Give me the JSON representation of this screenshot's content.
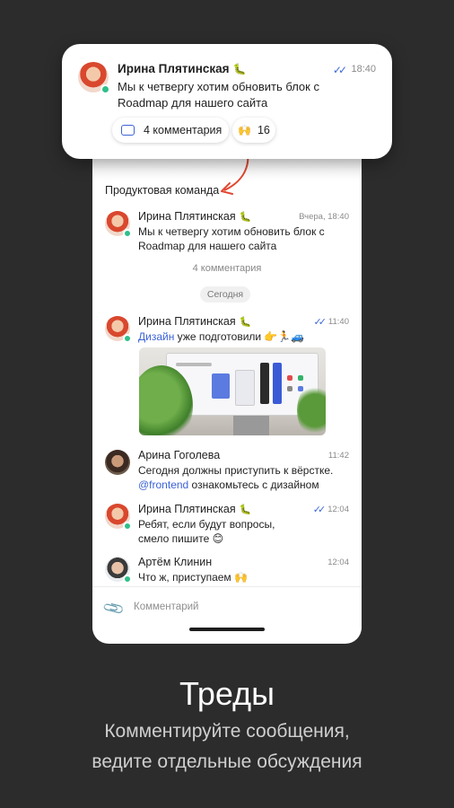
{
  "notification": {
    "name": "Ирина Плятинская",
    "name_emoji": "🐛",
    "ticks": "✓✓",
    "time": "18:40",
    "text": "Мы к четвергу хотим обновить блок с Roadmap для нашего сайта",
    "comments_chip": "4 комментария",
    "reaction_emoji": "🙌",
    "reaction_count": "16"
  },
  "thread": {
    "channel_title": "Продуктовая команда",
    "root": {
      "name": "Ирина Плятинская",
      "name_emoji": "🐛",
      "time": "Вчера, 18:40",
      "text": "Мы к четвергу хотим обновить блок с Roadmap для нашего сайта"
    },
    "comment_count": "4 комментария",
    "date_divider": "Сегодня",
    "messages": [
      {
        "name": "Ирина Плятинская",
        "name_emoji": "🐛",
        "ticks": "✓✓",
        "time": "11:40",
        "mention": "Дизайн",
        "text": " уже подготовили 👉🏃🚙"
      },
      {
        "name": "Арина Гоголева",
        "time": "11:42",
        "text_line1": "Сегодня должны приступить к вёрстке.",
        "mention": "@frontend",
        "text_line2": " ознакомьтесь с дизайном"
      },
      {
        "name": "Ирина Плятинская",
        "name_emoji": "🐛",
        "ticks": "✓✓",
        "time": "12:04",
        "text": "Ребят, если будут вопросы, смело пишите 😊"
      },
      {
        "name": "Артём Клинин",
        "time": "12:04",
        "text": "Что ж, приступаем 🙌"
      }
    ],
    "composer_placeholder": "Комментарий"
  },
  "promo": {
    "headline": "Треды",
    "subline_1": "Комментируйте сообщения,",
    "subline_2": "ведите отдельные обсуждения"
  },
  "colors": {
    "background": "#2c2c2c",
    "accent": "#3c63d6",
    "online": "#2fbf8a",
    "arrow": "#e2462f"
  }
}
